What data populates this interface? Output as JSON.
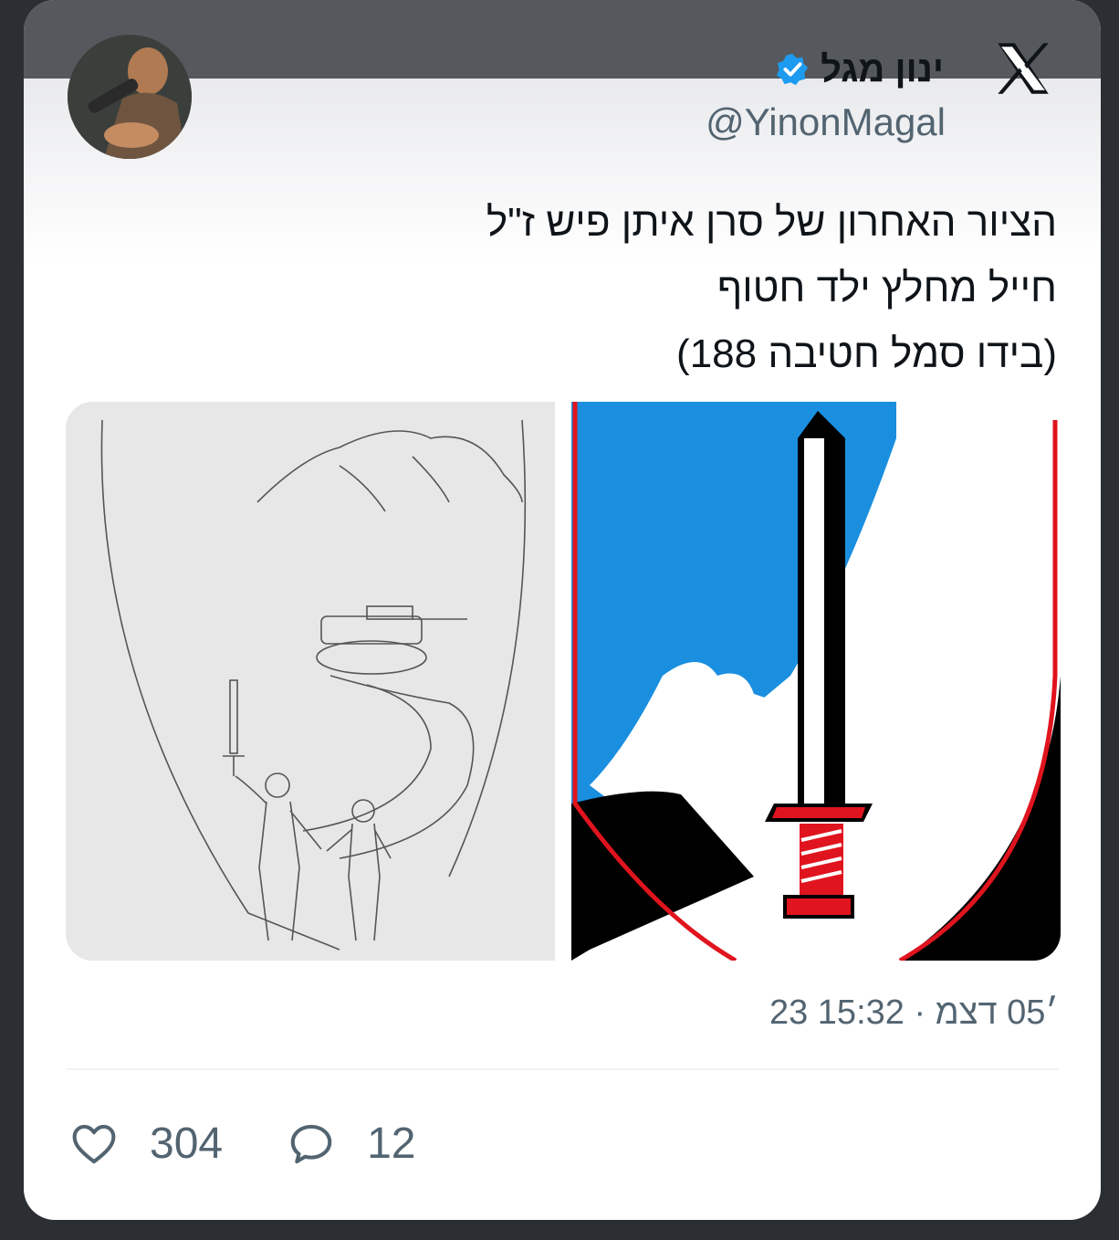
{
  "author": {
    "name": "ינון מגל",
    "handle": "@YinonMagal",
    "verified": true
  },
  "platform_logo": "x-logo",
  "tweet": {
    "lines": [
      "הציור האחרון של סרן איתן פיש ז\"ל",
      "חייל מחלץ ילד חטוף",
      "(בידו סמל חטיבה 188)"
    ],
    "timestamp": "23 ׳05 דצמ · 15:32"
  },
  "media": [
    {
      "kind": "pencil-drawing",
      "description_icon": "drawing-image"
    },
    {
      "kind": "brigade-emblem",
      "description_icon": "emblem-image"
    }
  ],
  "stats": {
    "likes": "304",
    "replies": "12"
  },
  "colors": {
    "text_primary": "#0f1419",
    "text_secondary": "#536471",
    "verified_blue": "#1d9bf0",
    "emblem_blue": "#1a8fe0",
    "emblem_red": "#e0141e"
  }
}
